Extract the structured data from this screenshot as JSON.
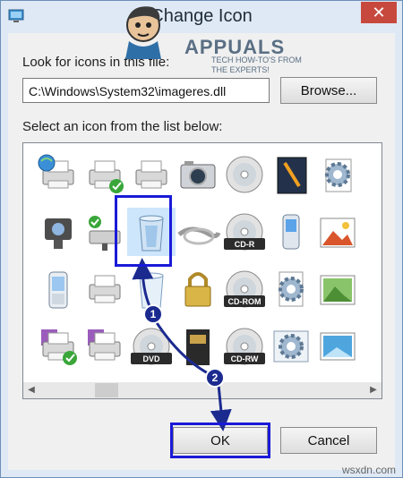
{
  "window": {
    "title": "Change Icon",
    "close_glyph": "✕"
  },
  "look_label": "Look for icons in this file:",
  "path_value": "C:\\Windows\\System32\\imageres.dll",
  "browse_label": "Browse...",
  "select_label": "Select an icon from the list below:",
  "icons": [
    {
      "name": "network-printer-icon"
    },
    {
      "name": "default-printer-icon"
    },
    {
      "name": "printer-icon"
    },
    {
      "name": "camera-icon"
    },
    {
      "name": "cd-disc-icon"
    },
    {
      "name": "book-icon"
    },
    {
      "name": "settings-gear-icon"
    },
    {
      "name": "folder-partial-icon"
    },
    {
      "name": "webcam-icon"
    },
    {
      "name": "network-drive-icon"
    },
    {
      "name": "recycle-bin-icon",
      "selected": true
    },
    {
      "name": "cable-icon"
    },
    {
      "name": "cd-r-icon",
      "text": "CD-R"
    },
    {
      "name": "mobile-phone-icon"
    },
    {
      "name": "picture-icon"
    },
    {
      "name": "folder-partial-icon"
    },
    {
      "name": "mobile-device-icon"
    },
    {
      "name": "printer-icon"
    },
    {
      "name": "recycle-bin-empty-icon"
    },
    {
      "name": "lock-icon"
    },
    {
      "name": "cd-rom-icon",
      "text": "CD-ROM"
    },
    {
      "name": "document-gear-icon"
    },
    {
      "name": "landscape-picture-icon"
    },
    {
      "name": "drive-partial-icon"
    },
    {
      "name": "floppy-printer-icon"
    },
    {
      "name": "fax-printer-icon"
    },
    {
      "name": "dvd-icon",
      "text": "DVD"
    },
    {
      "name": "memory-card-icon"
    },
    {
      "name": "cd-rw-icon",
      "text": "CD-RW"
    },
    {
      "name": "window-gear-icon"
    },
    {
      "name": "desktop-picture-icon"
    },
    {
      "name": "cable-partial-icon"
    }
  ],
  "ok_label": "OK",
  "cancel_label": "Cancel",
  "annotations": {
    "step1": "1",
    "step2": "2"
  },
  "watermark": {
    "brand": "APPUALS",
    "tagline_1": "TECH HOW-TO'S FROM",
    "tagline_2": "THE EXPERTS!",
    "footer": "wsxdn.com"
  },
  "colors": {
    "highlight": "#1a1ad8",
    "badge": "#1b2a8f",
    "close": "#c7493e"
  }
}
